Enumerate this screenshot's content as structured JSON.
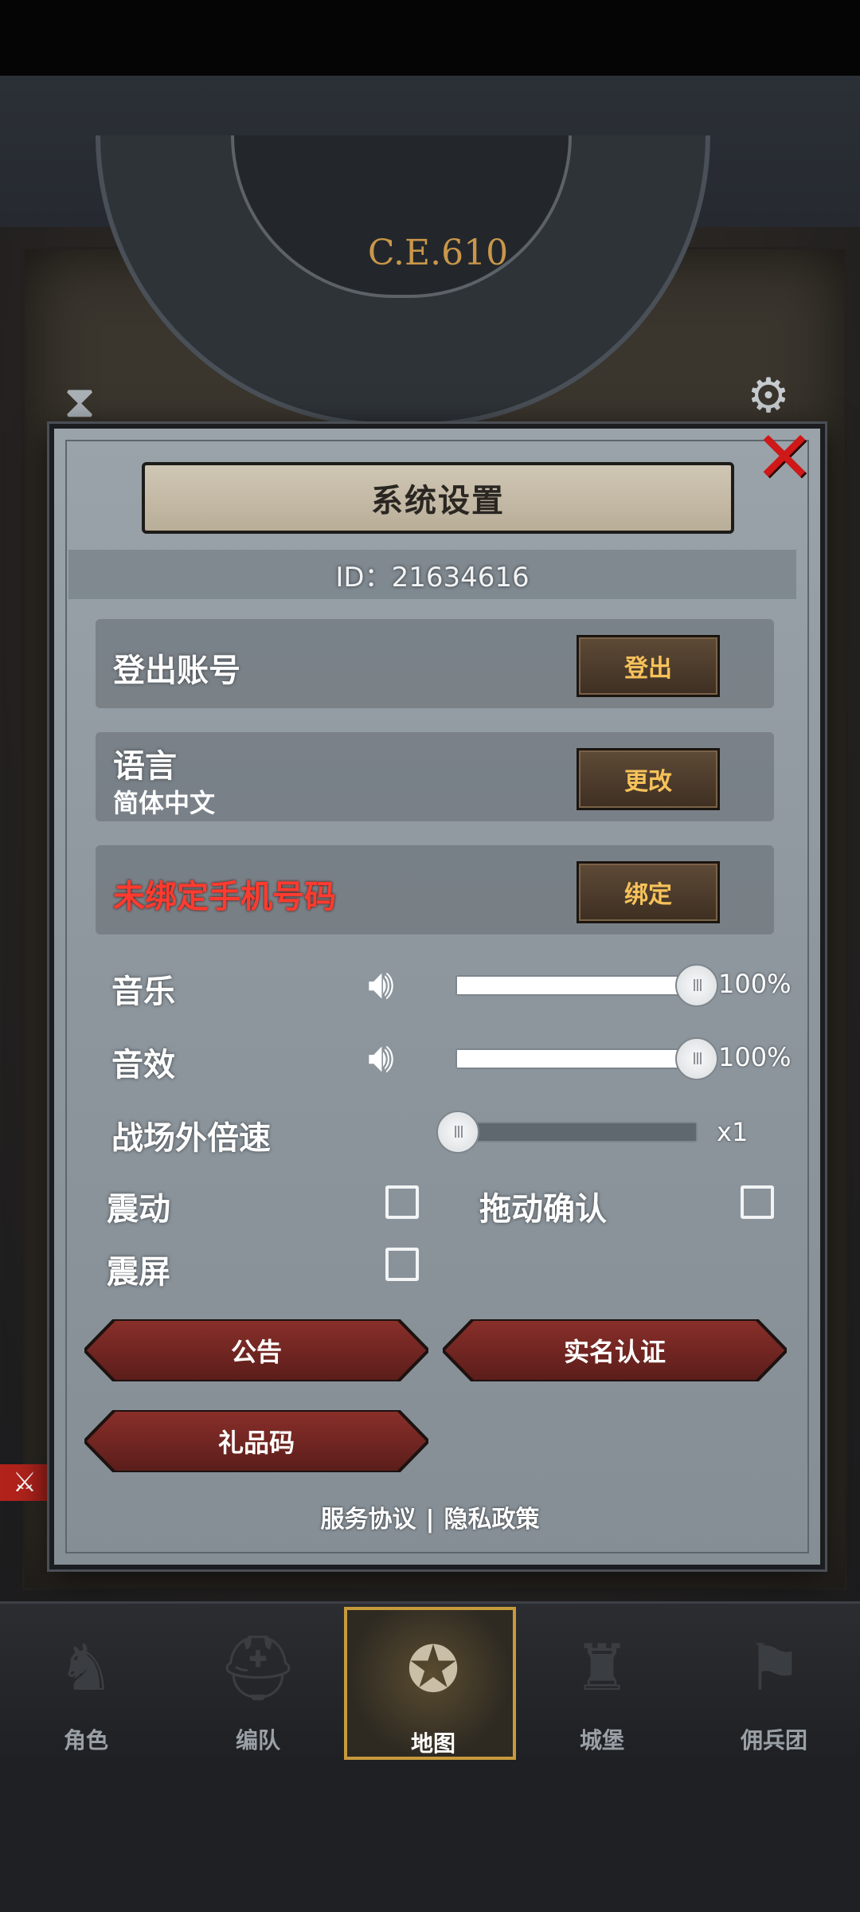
{
  "background": {
    "era": "C.E.610"
  },
  "modal": {
    "title": "系统设置",
    "id_text": "ID：21634616",
    "rows": [
      {
        "label": "登出账号",
        "button": "登出"
      },
      {
        "label": "语言",
        "sub": "简体中文",
        "button": "更改"
      },
      {
        "label": "未绑定手机号码",
        "button": "绑定",
        "label_color": "#ff3b2f"
      }
    ],
    "sliders": [
      {
        "label": "音乐",
        "value_text": "100%",
        "level": 1.0
      },
      {
        "label": "音效",
        "value_text": "100%",
        "level": 1.0
      },
      {
        "label": "战场外倍速",
        "value_text": "x1",
        "level": 0.0
      }
    ],
    "checkboxes": {
      "vibrate": "震动",
      "drag_confirm": "拖动确认",
      "screen_shake": "震屏"
    },
    "buttons": {
      "announcement": "公告",
      "real_name": "实名认证",
      "gift_code": "礼品码"
    },
    "links": {
      "terms": "服务协议",
      "separator": "|",
      "privacy": "隐私政策"
    }
  },
  "nav": [
    {
      "label": "角色",
      "icon": "knight-icon"
    },
    {
      "label": "编队",
      "icon": "helmet-icon"
    },
    {
      "label": "地图",
      "icon": "compass-icon",
      "active": true
    },
    {
      "label": "城堡",
      "icon": "castle-icon"
    },
    {
      "label": "佣兵团",
      "icon": "banner-icon"
    }
  ],
  "colors": {
    "accent_gold": "#c79a3c",
    "button_text": "#f6c25a",
    "warning": "#ff3b2f",
    "close_red": "#d01818"
  }
}
